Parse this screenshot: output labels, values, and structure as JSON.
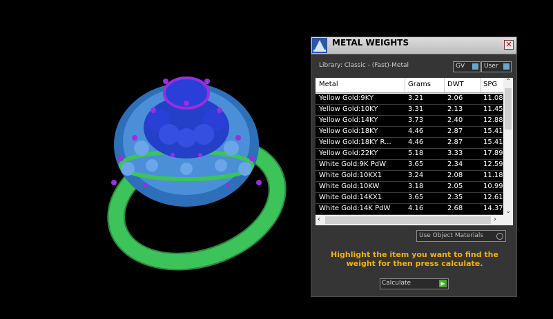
{
  "panel": {
    "title": "METAL WEIGHTS",
    "close_glyph": "✕",
    "library_label": "Library: Classic - (Fast)-Metal",
    "gv_label": "GV",
    "user_label": "User",
    "use_object_materials": "Use Object Materials",
    "hint": "Highlight the item you want to find the weight for then press calculate.",
    "calculate_label": "Calculate",
    "logo_icon": "wizard-hat-icon"
  },
  "table": {
    "headers": [
      "Metal",
      "Grams",
      "DWT",
      "SPG"
    ],
    "rows": [
      [
        "Yellow Gold:9KY",
        "3.21",
        "2.06",
        "11.08"
      ],
      [
        "Yellow Gold:10KY",
        "3.31",
        "2.13",
        "11.45"
      ],
      [
        "Yellow Gold:14KY",
        "3.73",
        "2.40",
        "12.88"
      ],
      [
        "Yellow Gold:18KY",
        "4.46",
        "2.87",
        "15.41"
      ],
      [
        "Yellow Gold:18KY R...",
        "4.46",
        "2.87",
        "15.41"
      ],
      [
        "Yellow Gold:22KY",
        "5.18",
        "3.33",
        "17.89"
      ],
      [
        "White Gold:9K PdW",
        "3.65",
        "2.34",
        "12.59"
      ],
      [
        "White Gold:10KX1",
        "3.24",
        "2.08",
        "11.18"
      ],
      [
        "White Gold:10KW",
        "3.18",
        "2.05",
        "10.99"
      ],
      [
        "White Gold:14KX1",
        "3.65",
        "2.35",
        "12.61"
      ],
      [
        "White Gold:14K PdW",
        "4.16",
        "2.68",
        "14.37"
      ]
    ]
  },
  "colors": {
    "ring_band": "#3cc45a",
    "stones": "#2a3fd8",
    "prongs": "#9a2ee0",
    "accent_text": "#f2b400"
  }
}
